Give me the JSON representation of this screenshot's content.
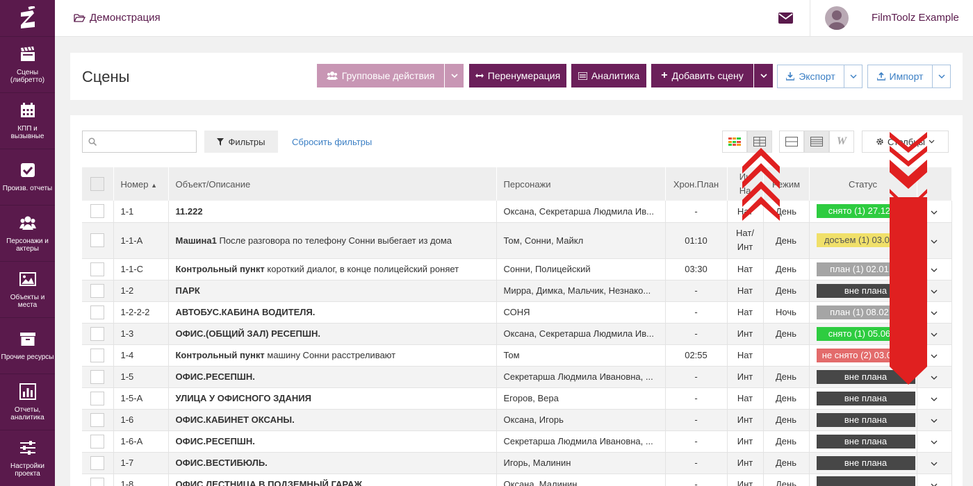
{
  "app": {
    "breadcrumb": "Демонстрация",
    "username": "FilmToolz Example"
  },
  "sidebar": {
    "items": [
      {
        "label": "Сцены (либретто)",
        "icon": "clapperboard-icon"
      },
      {
        "label": "КПП и вызывные",
        "icon": "calendar-icon"
      },
      {
        "label": "Произв. отчеты",
        "icon": "checkbox-icon"
      },
      {
        "label": "Персонажи и актеры",
        "icon": "users-icon"
      },
      {
        "label": "Объекты и места",
        "icon": "image-icon"
      },
      {
        "label": "Прочие ресурсы",
        "icon": "archive-icon"
      },
      {
        "label": "Отчеты, аналитика",
        "icon": "bar-chart-icon"
      },
      {
        "label": "Настройки проекта",
        "icon": "sliders-icon"
      }
    ]
  },
  "header": {
    "title": "Сцены",
    "group_actions": "Групповые действия",
    "renumber": "Перенумерация",
    "analytics": "Аналитика",
    "add_scene": "Добавить сцену",
    "export": "Экспорт",
    "import": "Импорт"
  },
  "toolbar": {
    "search_placeholder": "",
    "filters": "Фильтры",
    "reset_filters": "Сбросить фильтры",
    "columns": "Столбцы"
  },
  "table": {
    "headers": {
      "number": "Номер",
      "object": "Объект/Описание",
      "characters": "Персонажи",
      "chron": "Хрон.План",
      "intnat_1": "Ин",
      "intnat_2": "На",
      "mode": "Режим",
      "status": "Статус"
    },
    "rows": [
      {
        "num": "1-1",
        "title": "11.222",
        "desc": "",
        "chars": "Оксана, Секретарша Людмила Ив...",
        "chron": "-",
        "intnat": "Нат",
        "mode": "День",
        "status": "снято (1) 27.12.17",
        "status_kind": "green"
      },
      {
        "num": "1-1-А",
        "title": "Машина1",
        "desc": "После разговора по телефону Сонни выбегает из дома",
        "chars": "Том, Сонни, Майкл",
        "chron": "01:10",
        "intnat": "Нат/ Инт",
        "mode": "День",
        "status": "досъем (1) 03.01.18",
        "status_kind": "yellow"
      },
      {
        "num": "1-1-С",
        "title": "Контрольный пункт",
        "desc": "короткий диалог, в конце полицейский роняет",
        "chars": "Сонни, Полицейский",
        "chron": "03:30",
        "intnat": "Нат",
        "mode": "День",
        "status": "план (1) 02.01.18",
        "status_kind": "gray"
      },
      {
        "num": "1-2",
        "title": "ПАРК",
        "desc": "",
        "chars": "Мирра, Димка, Мальчик, Незнако...",
        "chron": "-",
        "intnat": "Нат",
        "mode": "День",
        "status": "вне плана",
        "status_kind": "dark"
      },
      {
        "num": "1-2-2-2",
        "title": "АВТОБУС.КАБИНА ВОДИТЕЛЯ.",
        "desc": "",
        "chars": "СОНЯ",
        "chron": "-",
        "intnat": "Нат",
        "mode": "Ночь",
        "status": "план (1) 08.02.18",
        "status_kind": "gray"
      },
      {
        "num": "1-3",
        "title": "ОФИС.(ОБЩИЙ ЗАЛ) РЕСЕПШН.",
        "desc": "",
        "chars": "Оксана, Секретарша Людмила Ив...",
        "chron": "-",
        "intnat": "Инт",
        "mode": "День",
        "status": "снято (1) 05.06.18",
        "status_kind": "green"
      },
      {
        "num": "1-4",
        "title": "Контрольный пункт",
        "desc": "машину Сонни расстреливают",
        "chars": "Том",
        "chron": "02:55",
        "intnat": "Нат",
        "mode": "",
        "status": "не снято (2) 03.01.18",
        "status_kind": "red"
      },
      {
        "num": "1-5",
        "title": "ОФИС.РЕСЕПШН.",
        "desc": "",
        "chars": "Секретарша Людмила Ивановна, ...",
        "chron": "-",
        "intnat": "Инт",
        "mode": "День",
        "status": "вне плана",
        "status_kind": "dark"
      },
      {
        "num": "1-5-А",
        "title": "УЛИЦА У ОФИСНОГО ЗДАНИЯ",
        "desc": "",
        "chars": "Егоров, Вера",
        "chron": "-",
        "intnat": "Нат",
        "mode": "День",
        "status": "вне плана",
        "status_kind": "dark"
      },
      {
        "num": "1-6",
        "title": "ОФИС.КАБИНЕТ ОКСАНЫ.",
        "desc": "",
        "chars": "Оксана, Игорь",
        "chron": "-",
        "intnat": "Инт",
        "mode": "День",
        "status": "вне плана",
        "status_kind": "dark"
      },
      {
        "num": "1-6-А",
        "title": "ОФИС.РЕСЕПШН.",
        "desc": "",
        "chars": "Секретарша Людмила Ивановна, ...",
        "chron": "-",
        "intnat": "Инт",
        "mode": "День",
        "status": "вне плана",
        "status_kind": "dark"
      },
      {
        "num": "1-7",
        "title": "ОФИС.ВЕСТИБЮЛЬ.",
        "desc": "",
        "chars": "Игорь, Малинин",
        "chron": "-",
        "intnat": "Инт",
        "mode": "День",
        "status": "вне плана",
        "status_kind": "dark"
      },
      {
        "num": "1-8",
        "title": "ОФИС.ЛЕСТНИЦА В ПОДЗЕМНЫЙ ГАРАЖ.",
        "desc": "",
        "chars": "Оксана, Малинин",
        "chron": "-",
        "intnat": "Инт",
        "mode": "День",
        "status": "",
        "status_kind": "dark"
      }
    ]
  },
  "colors": {
    "brand": "#5a1a4c",
    "accent_button": "#6b1f5a",
    "link": "#3b7fc4",
    "status_green": "#2ecc40",
    "status_yellow": "#f0e06a",
    "status_gray": "#a5a5a5",
    "status_dark": "#474747",
    "status_red": "#e36b6b",
    "annotation_arrow": "#e02020"
  }
}
